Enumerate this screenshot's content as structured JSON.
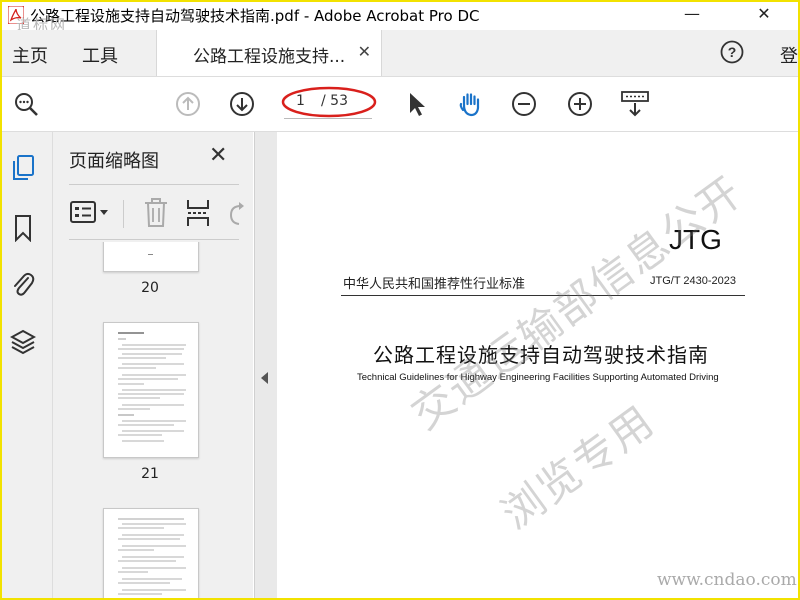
{
  "window": {
    "title": "公路工程设施支持自动驾驶技术指南.pdf - Adobe Acrobat Pro DC",
    "minimize": "—",
    "close": "✕",
    "corner_watermark": "道标网"
  },
  "menu": {
    "home": "主页",
    "tools": "工具",
    "doc_tab_label": "公路工程设施支持...",
    "doc_tab_close": "✕",
    "help_icon": "help-circle-icon",
    "login": "登录"
  },
  "toolbar": {
    "page_current": "1",
    "page_total": "/ 53",
    "highlight_color": "#d9201c",
    "accent_color": "#1a73c9"
  },
  "thumbnails": {
    "title": "页面缩略图",
    "close": "✕",
    "pages": [
      {
        "label": "20"
      },
      {
        "label": "21"
      },
      {
        "label": ""
      }
    ]
  },
  "document": {
    "code": "JTG",
    "standard_left": "中华人民共和国推荐性行业标准",
    "standard_right": "JTG/T 2430-2023",
    "title_cn": "公路工程设施支持自动驾驶技术指南",
    "title_en": "Technical Guidelines for Highway Engineering Facilities Supporting Automated Driving",
    "watermark_line1": "交通运输部信息公开",
    "watermark_line2": "浏览专用",
    "site_watermark": "www.cndao.com"
  }
}
